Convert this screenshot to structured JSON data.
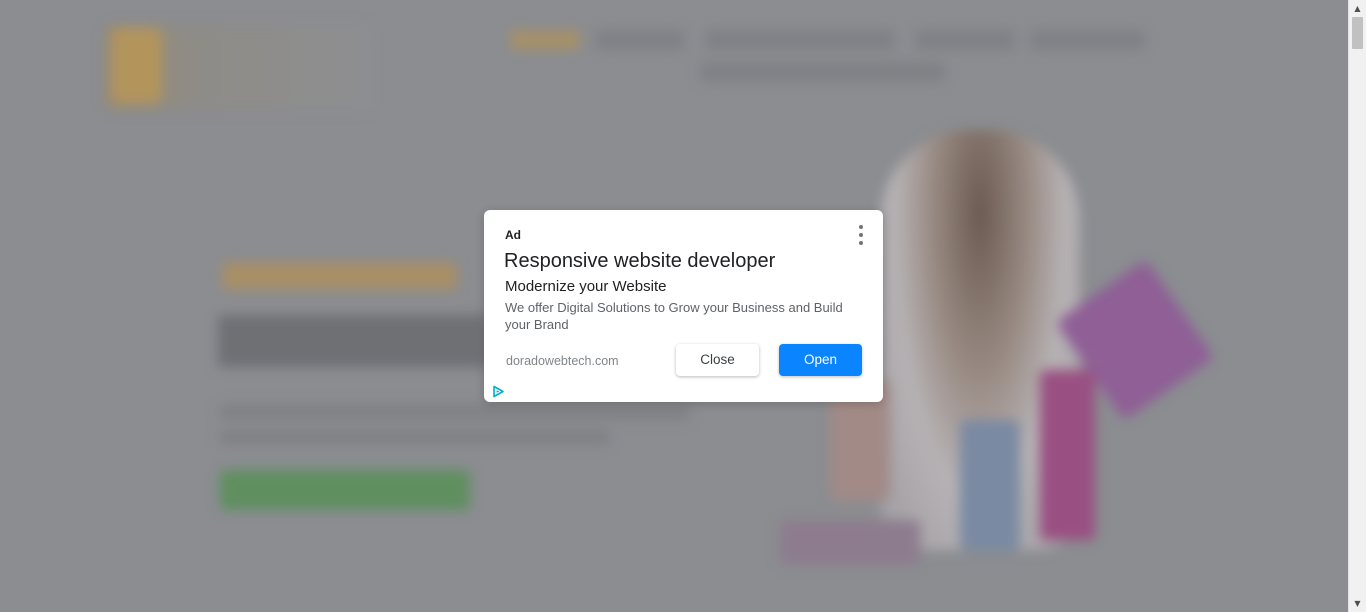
{
  "ad": {
    "badge": "Ad",
    "title": "Responsive website developer",
    "subtitle": "Modernize your Website",
    "description": "We offer Digital Solutions to Grow your Business and Build your Brand",
    "display_url": "doradowebtech.com",
    "close_label": "Close",
    "open_label": "Open",
    "menu_icon": "more-vert-icon",
    "adchoices_icon": "adchoices-icon"
  },
  "scrollbar": {
    "up_icon": "scroll-up-arrow-icon",
    "down_icon": "scroll-down-arrow-icon",
    "up_glyph": "▲",
    "down_glyph": "▼"
  },
  "colors": {
    "overlay": "#8b8d91",
    "open_button": "#0a84ff",
    "adchoices": "#00aecd"
  }
}
